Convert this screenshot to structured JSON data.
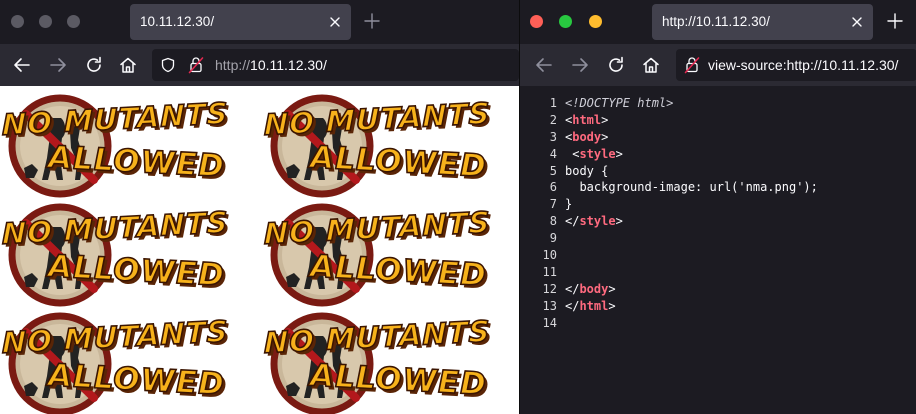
{
  "colors": {
    "traffic_close": "#fe5f57",
    "traffic_min": "#28c840",
    "traffic_max": "#febc2e",
    "tag_color": "#ff6a7f",
    "page_bg": "#ffffff",
    "editor_bg": "#1c1b22"
  },
  "left_window": {
    "tab_title": "10.11.12.30/",
    "url_prefix": "http://",
    "url_host": "10.11.12.30/",
    "icons": [
      "back-icon",
      "forward-icon",
      "reload-icon",
      "home-icon",
      "shield-icon",
      "insecure-lock-icon"
    ],
    "page": {
      "logo_top_text": "NO MUTANTS",
      "logo_bottom_text": "ALLOWED"
    }
  },
  "right_window": {
    "tab_title": "http://10.11.12.30/",
    "url_prefix": "view-source:",
    "url_host": "http://10.11.12.30/",
    "source_lines": [
      {
        "n": "1",
        "parts": [
          {
            "t": "<!DOCTYPE html>",
            "c": "doctype"
          }
        ]
      },
      {
        "n": "2",
        "parts": [
          {
            "t": "<",
            "c": "punct"
          },
          {
            "t": "html",
            "c": "tag"
          },
          {
            "t": ">",
            "c": "punct"
          }
        ]
      },
      {
        "n": "3",
        "parts": [
          {
            "t": "<",
            "c": "punct"
          },
          {
            "t": "body",
            "c": "tag"
          },
          {
            "t": ">",
            "c": "punct"
          }
        ]
      },
      {
        "n": "4",
        "parts": [
          {
            "t": " <",
            "c": "punct"
          },
          {
            "t": "style",
            "c": "tag"
          },
          {
            "t": ">",
            "c": "punct"
          }
        ]
      },
      {
        "n": "5",
        "parts": [
          {
            "t": "body {",
            "c": "text"
          }
        ]
      },
      {
        "n": "6",
        "parts": [
          {
            "t": "  background-image: url('nma.png');",
            "c": "text"
          }
        ]
      },
      {
        "n": "7",
        "parts": [
          {
            "t": "}",
            "c": "text"
          }
        ]
      },
      {
        "n": "8",
        "parts": [
          {
            "t": "</",
            "c": "punct"
          },
          {
            "t": "style",
            "c": "tag"
          },
          {
            "t": ">",
            "c": "punct"
          }
        ]
      },
      {
        "n": "9",
        "parts": []
      },
      {
        "n": "10",
        "parts": []
      },
      {
        "n": "11",
        "parts": []
      },
      {
        "n": "12",
        "parts": [
          {
            "t": "</",
            "c": "punct"
          },
          {
            "t": "body",
            "c": "tag"
          },
          {
            "t": ">",
            "c": "punct"
          }
        ]
      },
      {
        "n": "13",
        "parts": [
          {
            "t": "</",
            "c": "punct"
          },
          {
            "t": "html",
            "c": "tag"
          },
          {
            "t": ">",
            "c": "punct"
          }
        ]
      },
      {
        "n": "14",
        "parts": []
      }
    ]
  }
}
